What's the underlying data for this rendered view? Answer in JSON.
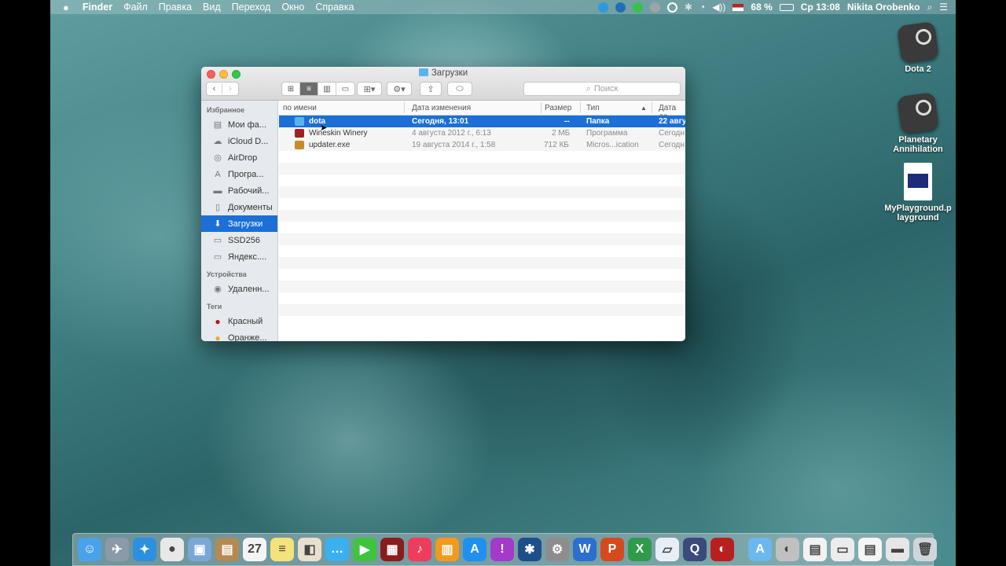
{
  "menubar": {
    "apple": "",
    "app_name": "Finder",
    "items": [
      "Файл",
      "Правка",
      "Вид",
      "Переход",
      "Окно",
      "Справка"
    ],
    "battery": "68 %",
    "clock": "Ср 13:08",
    "user": "Nikita Orobenko"
  },
  "desktop_icons": [
    {
      "label": "Dota 2",
      "icon": "steam-icon"
    },
    {
      "label": "Planetary Annihilation",
      "icon": "steam-icon"
    },
    {
      "label": "MyPlayground.playground",
      "icon": "playground-doc-icon"
    }
  ],
  "window": {
    "title": "Загрузки",
    "search_placeholder": "Поиск",
    "sidebar": {
      "favorites_header": "Избранное",
      "favorites": [
        {
          "label": "Мои фа...",
          "icon": "all-files-icon"
        },
        {
          "label": "iCloud D...",
          "icon": "cloud-icon"
        },
        {
          "label": "AirDrop",
          "icon": "airdrop-icon"
        },
        {
          "label": "Програ...",
          "icon": "applications-icon"
        },
        {
          "label": "Рабочий...",
          "icon": "desktop-icon"
        },
        {
          "label": "Документы",
          "icon": "documents-icon"
        },
        {
          "label": "Загрузки",
          "icon": "downloads-icon",
          "selected": true
        },
        {
          "label": "SSD256",
          "icon": "drive-icon"
        },
        {
          "label": "Яндекс....",
          "icon": "folder-icon"
        }
      ],
      "devices_header": "Устройства",
      "devices": [
        {
          "label": "Удаленн...",
          "icon": "remote-disc-icon"
        }
      ],
      "tags_header": "Теги",
      "tags": [
        {
          "label": "Красный",
          "color": "#d0021b"
        },
        {
          "label": "Оранже...",
          "color": "#f5a623"
        }
      ]
    },
    "columns": {
      "name": "по имени",
      "date": "Дата изменения",
      "size": "Размер",
      "kind": "Тип",
      "added": "Дата до"
    },
    "files": [
      {
        "name": "dota",
        "date": "Сегодня, 13:01",
        "size": "--",
        "kind": "Папка",
        "added": "22 авгу",
        "selected": true,
        "icon_color": "#5ab4ec"
      },
      {
        "name": "Wineskin Winery",
        "date": "4 августа 2012 г., 6:13",
        "size": "2 МБ",
        "kind": "Программа",
        "added": "Сегодн",
        "icon_color": "#a02020"
      },
      {
        "name": "updater.exe",
        "date": "19 августа 2014 г., 1:58",
        "size": "712 КБ",
        "kind": "Micros...ication",
        "added": "Сегодн",
        "icon_color": "#c98a2a"
      }
    ]
  },
  "dock": {
    "apps": [
      {
        "name": "finder-icon",
        "bg": "#4aa3e8",
        "glyph": "☺"
      },
      {
        "name": "launchpad-icon",
        "bg": "#8a9aa8",
        "glyph": "✈"
      },
      {
        "name": "safari-icon",
        "bg": "#2d8fe0",
        "glyph": "✦"
      },
      {
        "name": "chrome-icon",
        "bg": "#e8e8e8",
        "glyph": "●"
      },
      {
        "name": "preview-icon",
        "bg": "#7aa7d6",
        "glyph": "▣"
      },
      {
        "name": "contacts-icon",
        "bg": "#b58a52",
        "glyph": "▤"
      },
      {
        "name": "calendar-icon",
        "bg": "#f4f4f4",
        "glyph": "27"
      },
      {
        "name": "notes-icon",
        "bg": "#f4e27a",
        "glyph": "≡"
      },
      {
        "name": "photos-icon",
        "bg": "#e8e0cf",
        "glyph": "◧"
      },
      {
        "name": "messages-icon",
        "bg": "#3ab0f0",
        "glyph": "…"
      },
      {
        "name": "facetime-icon",
        "bg": "#3ec43e",
        "glyph": "▶"
      },
      {
        "name": "photo-booth-icon",
        "bg": "#8a1c1c",
        "glyph": "▦"
      },
      {
        "name": "itunes-icon",
        "bg": "#f03c5c",
        "glyph": "♪"
      },
      {
        "name": "ibooks-icon",
        "bg": "#f39a1b",
        "glyph": "▥"
      },
      {
        "name": "app-store-icon",
        "bg": "#1f8ff0",
        "glyph": "A"
      },
      {
        "name": "feedback-icon",
        "bg": "#a43ac9",
        "glyph": "!"
      },
      {
        "name": "xcode-icon",
        "bg": "#1e4f8a",
        "glyph": "✱"
      },
      {
        "name": "system-preferences-icon",
        "bg": "#8d8d8d",
        "glyph": "⚙"
      },
      {
        "name": "word-icon",
        "bg": "#2c6fcf",
        "glyph": "W"
      },
      {
        "name": "powerpoint-icon",
        "bg": "#d44a1e",
        "glyph": "P"
      },
      {
        "name": "excel-icon",
        "bg": "#2f9b4a",
        "glyph": "X"
      },
      {
        "name": "keynote-icon",
        "bg": "#e8eef6",
        "glyph": "▱"
      },
      {
        "name": "quicktime-icon",
        "bg": "#3a4a7a",
        "glyph": "Q"
      },
      {
        "name": "wineskin-icon",
        "bg": "#b82020",
        "glyph": "◐"
      }
    ],
    "stacks": [
      {
        "name": "applications-folder-icon",
        "bg": "#6cb8ee",
        "glyph": "A"
      },
      {
        "name": "wineskin-stack-icon",
        "bg": "#c0c0c0",
        "glyph": "◐"
      },
      {
        "name": "document-stack-icon",
        "bg": "#f2f2f2",
        "glyph": "▤"
      },
      {
        "name": "scanner-stack-icon",
        "bg": "#ececec",
        "glyph": "▭"
      },
      {
        "name": "pages-stack-icon",
        "bg": "#f5f5f5",
        "glyph": "▤"
      },
      {
        "name": "downloads-stack-icon",
        "bg": "#e6e6e6",
        "glyph": "▬"
      },
      {
        "name": "trash-icon",
        "bg": "#cfd6da",
        "glyph": "🗑"
      }
    ]
  }
}
